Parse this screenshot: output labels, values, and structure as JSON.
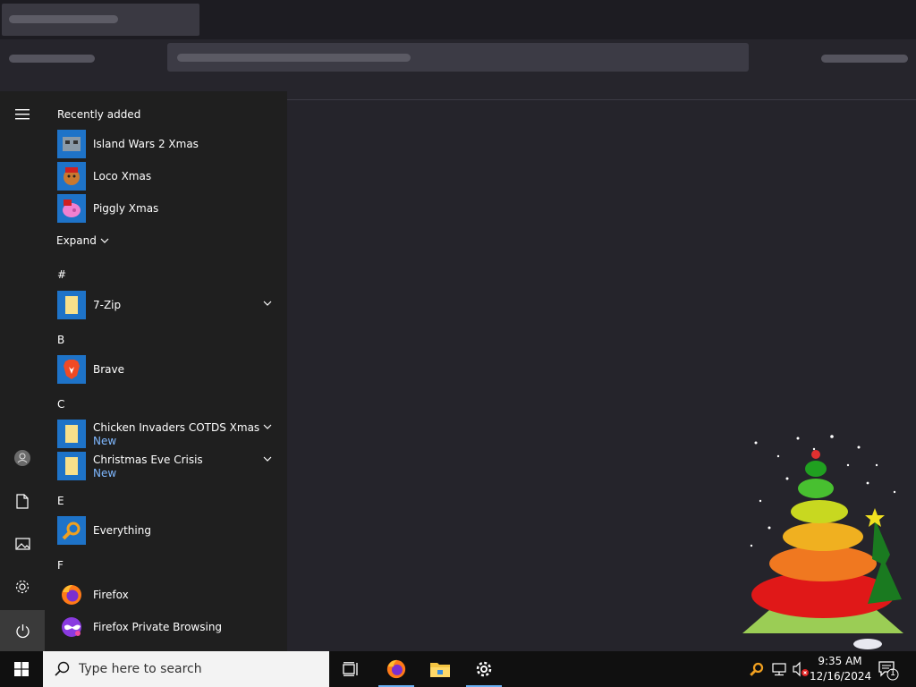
{
  "start_menu": {
    "recently_added_title": "Recently added",
    "recent": [
      {
        "name": "Island Wars 2 Xmas"
      },
      {
        "name": "Loco Xmas"
      },
      {
        "name": "Piggly Xmas"
      }
    ],
    "expand_label": "Expand",
    "groups": [
      {
        "letter": "#",
        "items": [
          {
            "name": "7-Zip"
          }
        ]
      },
      {
        "letter": "B",
        "items": [
          {
            "name": "Brave"
          }
        ]
      },
      {
        "letter": "C",
        "items": [
          {
            "name": "Chicken Invaders COTDS Xmas",
            "badge": "New"
          },
          {
            "name": "Christmas Eve Crisis",
            "badge": "New"
          }
        ]
      },
      {
        "letter": "E",
        "items": [
          {
            "name": "Everything"
          }
        ]
      },
      {
        "letter": "F",
        "items": [
          {
            "name": "Firefox"
          },
          {
            "name": "Firefox Private Browsing"
          }
        ]
      }
    ]
  },
  "taskbar": {
    "search_placeholder": "Type here to search",
    "time": "9:35 AM",
    "date": "12/16/2024",
    "notification_count": "1"
  },
  "colors": {
    "accent": "#1e73c8",
    "new_badge": "#7fb8ff",
    "start_bg": "#1f1f1f",
    "taskbar_bg": "#101010"
  }
}
